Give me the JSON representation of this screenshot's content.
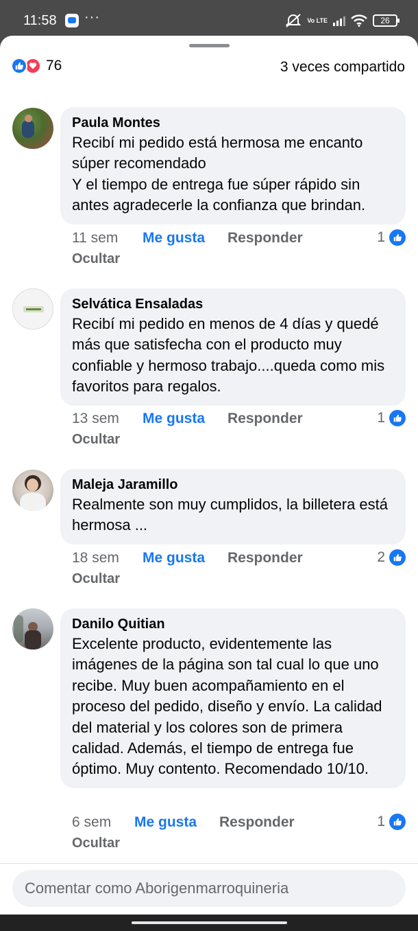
{
  "status_bar": {
    "time": "11:58",
    "more": "···",
    "network": "Vo LTE",
    "battery": "26"
  },
  "reactions": {
    "count": "76",
    "shares": "3 veces compartido"
  },
  "comments": [
    {
      "author": "Paula Montes",
      "text": "Recibí mi pedido está hermosa me encanto súper recomendado\nY el tiempo de entrega fue súper rápido sin antes agradecerle la confianza que brindan.",
      "time": "11 sem",
      "like_label": "Me gusta",
      "reply_label": "Responder",
      "hide_label": "Ocultar",
      "likes": "1"
    },
    {
      "author": "Selvática Ensaladas",
      "text": "Recibí mi pedido en menos de 4 días y quedé más que satisfecha con el producto muy confiable y hermoso trabajo....queda como mis favoritos para regalos.",
      "time": "13 sem",
      "like_label": "Me gusta",
      "reply_label": "Responder",
      "hide_label": "Ocultar",
      "likes": "1"
    },
    {
      "author": "Maleja Jaramillo",
      "text": "Realmente son muy cumplidos, la billetera está hermosa ...",
      "time": "18 sem",
      "like_label": "Me gusta",
      "reply_label": "Responder",
      "hide_label": "Ocultar",
      "likes": "2"
    },
    {
      "author": "Danilo Quitian",
      "text": "Excelente producto, evidentemente las imágenes de la página son tal cual lo que uno recibe. Muy buen acompañamiento en el proceso del pedido, diseño y envío. La calidad del material y los colores son de primera calidad. Además, el tiempo de entrega fue óptimo. Muy contento. Recomendado 10/10.",
      "time": "6 sem",
      "like_label": "Me gusta",
      "reply_label": "Responder",
      "hide_label": "Ocultar",
      "likes": "1"
    }
  ],
  "composer": {
    "placeholder": "Comentar como Aborigenmarroquineria"
  },
  "colors": {
    "accent": "#1877f2",
    "bubble": "#f0f2f5",
    "love": "#f33e58",
    "muted": "#65676b"
  }
}
